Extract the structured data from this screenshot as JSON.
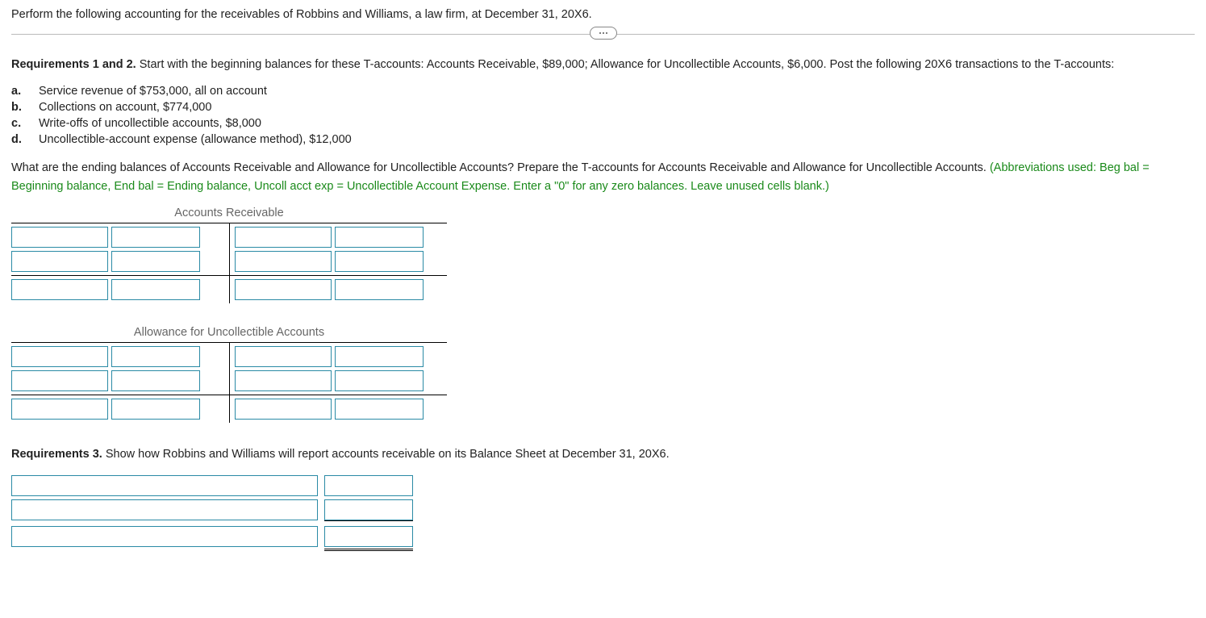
{
  "prompt": "Perform the following accounting for the receivables of Robbins and Williams, a law firm, at December 31, 20X6.",
  "requirements12": {
    "lead_bold": "Requirements 1 and 2.",
    "lead_text": " Start with the beginning balances for these T-accounts: Accounts Receivable, $89,000; Allowance for Uncollectible Accounts, $6,000. Post the following 20X6 transactions to the T-accounts:"
  },
  "transactions": [
    {
      "letter": "a.",
      "text": "Service revenue of $753,000, all on account"
    },
    {
      "letter": "b.",
      "text": "Collections on account, $774,000"
    },
    {
      "letter": "c.",
      "text": "Write-offs of uncollectible accounts, $8,000"
    },
    {
      "letter": "d.",
      "text": "Uncollectible-account expense (allowance method), $12,000"
    }
  ],
  "question_text": "What are the ending balances of Accounts Receivable and Allowance for Uncollectible Accounts? Prepare the T-accounts for Accounts Receivable and Allowance for Uncollectible Accounts. ",
  "hint_text": "(Abbreviations used: Beg bal = Beginning balance, End bal = Ending balance, Uncoll acct exp = Uncollectible Account Expense. Enter a \"0\" for any zero balances. Leave unused cells blank.)",
  "t_accounts": {
    "ar_title": "Accounts Receivable",
    "allow_title": "Allowance for Uncollectible Accounts"
  },
  "requirement3": {
    "lead_bold": "Requirements 3.",
    "lead_text": " Show how Robbins and Williams will report accounts receivable on its Balance Sheet at December 31, 20X6."
  }
}
